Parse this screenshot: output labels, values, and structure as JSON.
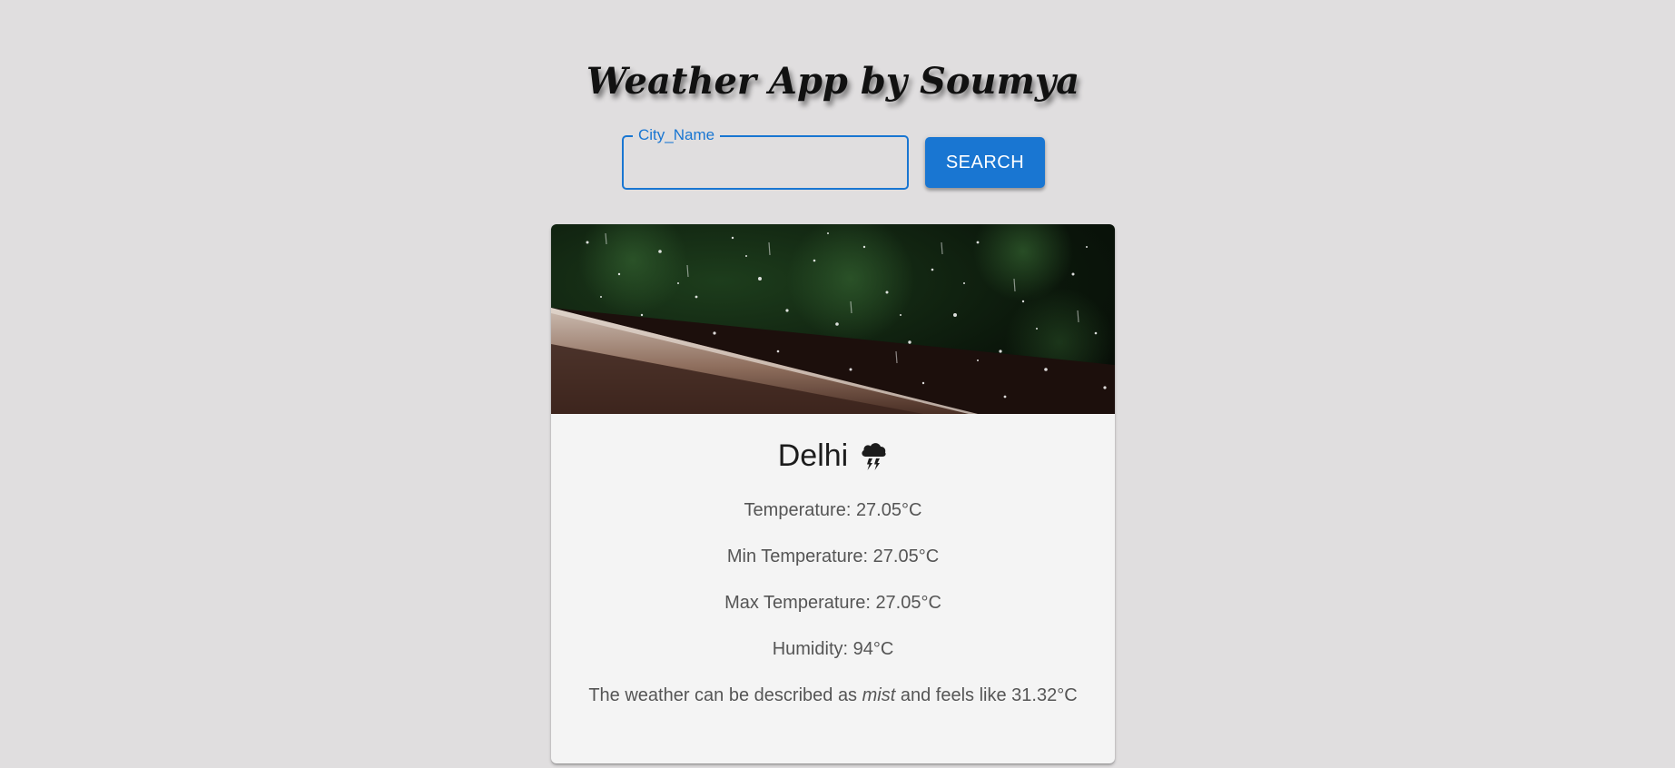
{
  "app": {
    "title": "Weather App by Soumya"
  },
  "search": {
    "label": "City_Name",
    "value": "",
    "button_label": "SEARCH"
  },
  "card": {
    "city": "Delhi",
    "weather_icon": "thunderstorm-cloud-icon",
    "temperature_label": "Temperature: ",
    "temperature_value": "27.05°C",
    "min_temp_label": "Min Temperature: ",
    "min_temp_value": "27.05°C",
    "max_temp_label": "Max Temperature: ",
    "max_temp_value": "27.05°C",
    "humidity_label": "Humidity: ",
    "humidity_value": "94°C",
    "description_prefix": "The weather can be described as ",
    "description_value": "mist",
    "description_mid": " and feels like ",
    "feels_like_value": "31.32°C"
  },
  "colors": {
    "background": "#e0dedf",
    "accent": "#1976d2",
    "card": "#f4f4f4"
  }
}
